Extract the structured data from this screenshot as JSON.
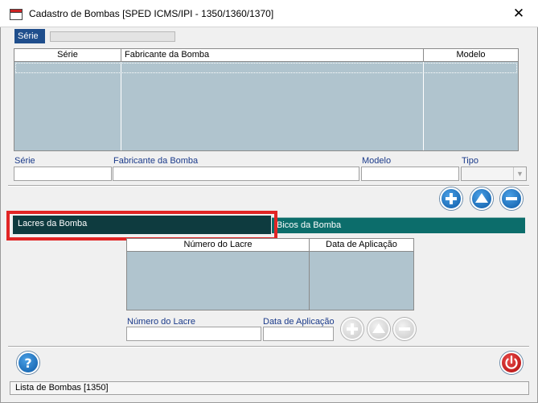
{
  "window": {
    "title": "Cadastro de Bombas  [SPED ICMS/IPI - 1350/1360/1370]"
  },
  "serie_header": {
    "label": "Série"
  },
  "pumps_table": {
    "columns": [
      "Série",
      "Fabricante da Bomba",
      "Modelo"
    ]
  },
  "pump_form": {
    "serie_label": "Série",
    "fabricante_label": "Fabricante da Bomba",
    "modelo_label": "Modelo",
    "tipo_label": "Tipo",
    "serie_value": "",
    "fabricante_value": "",
    "modelo_value": "",
    "tipo_value": ""
  },
  "tabs": [
    {
      "label": "Lacres da Bomba"
    },
    {
      "label": "Bicos da Bomba"
    }
  ],
  "seals_table": {
    "columns": [
      "Número do Lacre",
      "Data de Aplicação"
    ]
  },
  "seal_form": {
    "numero_label": "Número do Lacre",
    "data_label": "Data de Aplicação",
    "numero_value": "",
    "data_value": ""
  },
  "status_bar": {
    "text": "Lista de Bombas [1350]"
  },
  "colors": {
    "accent_blue": "#1f4e8c",
    "grid_fill": "#b0c4ce",
    "tab_active": "#0e3b3f",
    "tab_inactive": "#0c6d6b",
    "highlight_red": "#e12525"
  }
}
